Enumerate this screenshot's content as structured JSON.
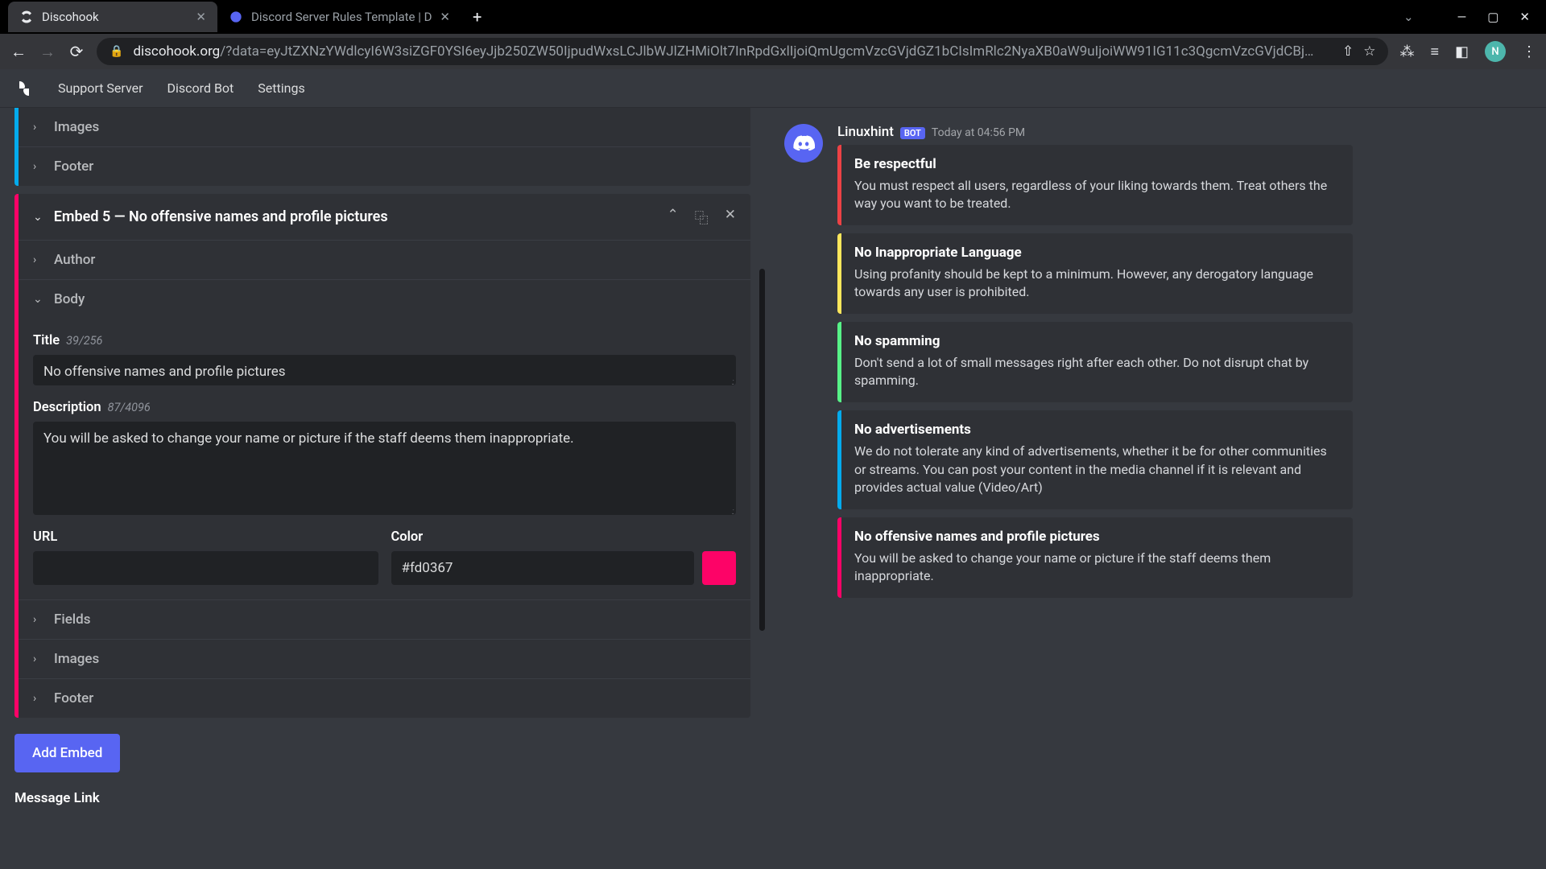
{
  "browser": {
    "tabs": [
      {
        "title": "Discohook",
        "active": true
      },
      {
        "title": "Discord Server Rules Template | D",
        "active": false
      }
    ],
    "url_domain": "discohook.org",
    "url_path": "/?data=eyJtZXNzYWdlcyI6W3siZGF0YSI6eyJjb250ZW50IjpudWxsLCJlbWJlZHMiOlt7InRpdGxlIjoiQmUgcmVzcGVjdGZ1bCIsImRlc2NyaXB0aW9uIjoiWW91IG11c3QgcmVzcGVjdCBj…",
    "avatar_letter": "N"
  },
  "nav": {
    "support": "Support Server",
    "bot": "Discord Bot",
    "settings": "Settings"
  },
  "editor": {
    "prev_embed_color": "#04abed",
    "prev_sections": {
      "images": "Images",
      "footer": "Footer"
    },
    "embed5": {
      "header": "Embed 5 — No offensive names and profile pictures",
      "color": "#fd0367",
      "sections": {
        "author": "Author",
        "body": "Body",
        "fields": "Fields",
        "images": "Images",
        "footer": "Footer"
      },
      "title_label": "Title",
      "title_count": "39/256",
      "title_value": "No offensive names and profile pictures",
      "desc_label": "Description",
      "desc_count": "87/4096",
      "desc_value": "You will be asked to change your name or picture if the staff deems them inappropriate.",
      "url_label": "URL",
      "url_value": "",
      "color_label": "Color",
      "color_value": "#fd0367"
    },
    "add_embed": "Add Embed",
    "message_link": "Message Link"
  },
  "preview": {
    "username": "Linuxhint",
    "bot_badge": "BOT",
    "timestamp": "Today at 04:56 PM",
    "embeds": [
      {
        "color": "#ed4245",
        "title": "Be respectful",
        "desc": "You must respect all users, regardless of your liking towards them. Treat others the way you want to be treated."
      },
      {
        "color": "#fee75c",
        "title": "No Inappropriate Language",
        "desc": "Using profanity should be kept to a minimum. However, any derogatory language towards any user is prohibited."
      },
      {
        "color": "#57f287",
        "title": "No spamming",
        "desc": "Don't send a lot of small messages right after each other. Do not disrupt chat by spamming."
      },
      {
        "color": "#04abed",
        "title": "No advertisements",
        "desc": "We do not tolerate any kind of advertisements, whether it be for other communities or streams. You can post your content in the media channel if it is relevant and provides actual value (Video/Art)"
      },
      {
        "color": "#fd0367",
        "title": "No offensive names and profile pictures",
        "desc": "You will be asked to change your name or picture if the staff deems them inappropriate."
      }
    ]
  }
}
